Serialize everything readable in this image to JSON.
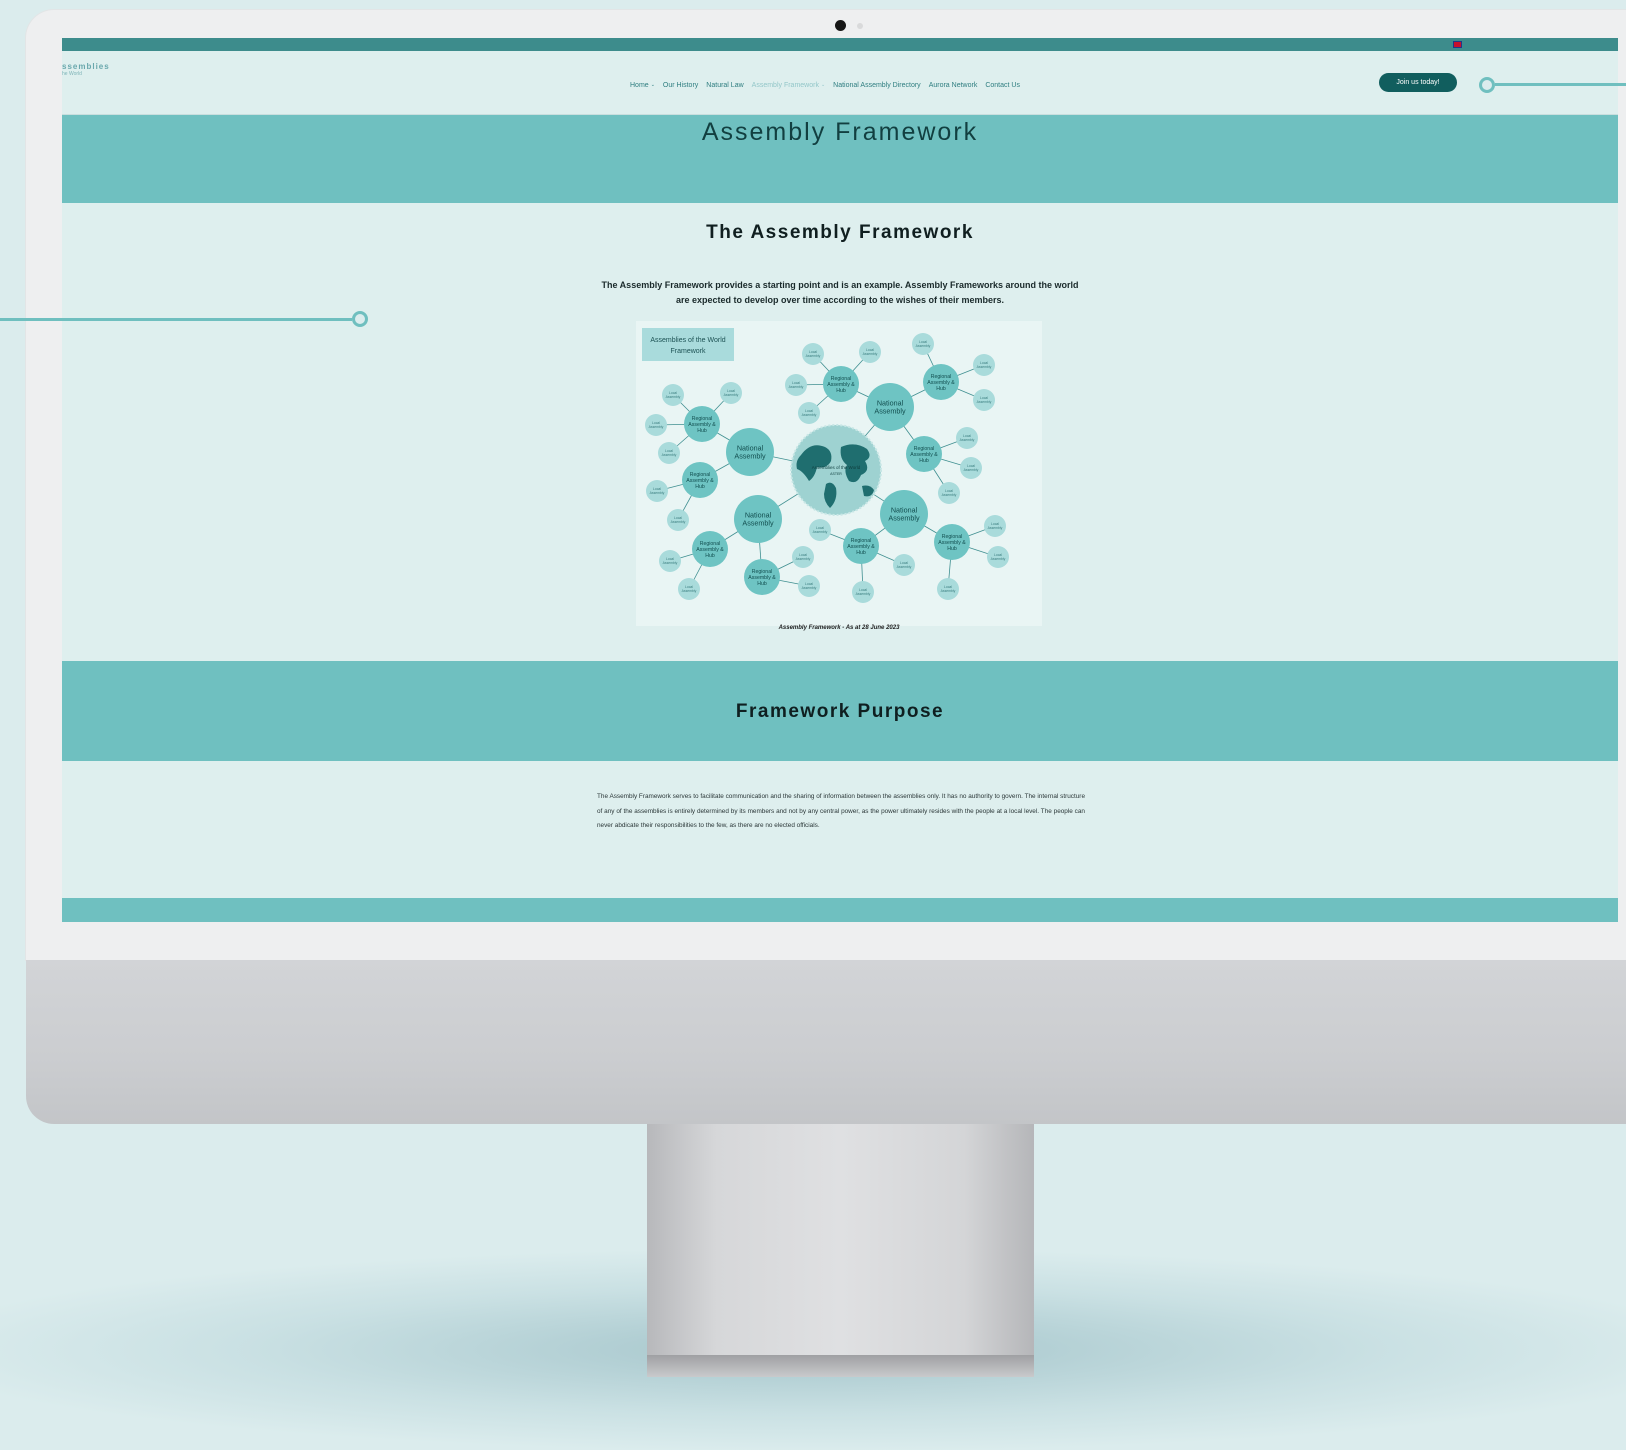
{
  "site": {
    "logo_text": "ssemblies",
    "logo_subtext": "he World"
  },
  "nav": {
    "items": [
      {
        "label": "Home",
        "has_dropdown": true
      },
      {
        "label": "Our History",
        "has_dropdown": false
      },
      {
        "label": "Natural Law",
        "has_dropdown": false
      },
      {
        "label": "Assembly Framework",
        "has_dropdown": true,
        "active": true
      },
      {
        "label": "National Assembly Directory",
        "has_dropdown": false
      },
      {
        "label": "Aurora Network",
        "has_dropdown": false
      },
      {
        "label": "Contact Us",
        "has_dropdown": false
      }
    ],
    "join_button": "Join us today!",
    "language_flag": "uk-flag-icon"
  },
  "hero": {
    "title": "Assembly Framework"
  },
  "framework_section": {
    "title": "The Assembly Framework",
    "intro": "The Assembly Framework provides a starting point and is an example. Assembly Frameworks around the world are expected to develop over time according to the wishes of their members."
  },
  "diagram": {
    "box_label_line1": "Assemblies of the World",
    "box_label_line2": "Framework",
    "center_label": "Assemblies of the World",
    "center_sublabel": "ASTER",
    "national_label": "National Assembly",
    "regional_label": "Regional Assembly & Hub",
    "local_label": "Local Assembly",
    "caption": "Assembly Framework - As at 28 June 2023"
  },
  "purpose_section": {
    "title": "Framework Purpose",
    "body": "The Assembly Framework serves to facilitate communication and the sharing of information between the assemblies only. It has no authority to govern. The internal structure of any of the assemblies is entirely determined by its members and not by any central power, as the power ultimately resides with the people at a local level. The people can never abdicate their responsibilities to the few, as there are no elected officials."
  },
  "colors": {
    "teal_band": "#6fc0c0",
    "dark_teal": "#115e5e",
    "page_bg": "#deefee",
    "top_bar": "#3d8c8c"
  }
}
